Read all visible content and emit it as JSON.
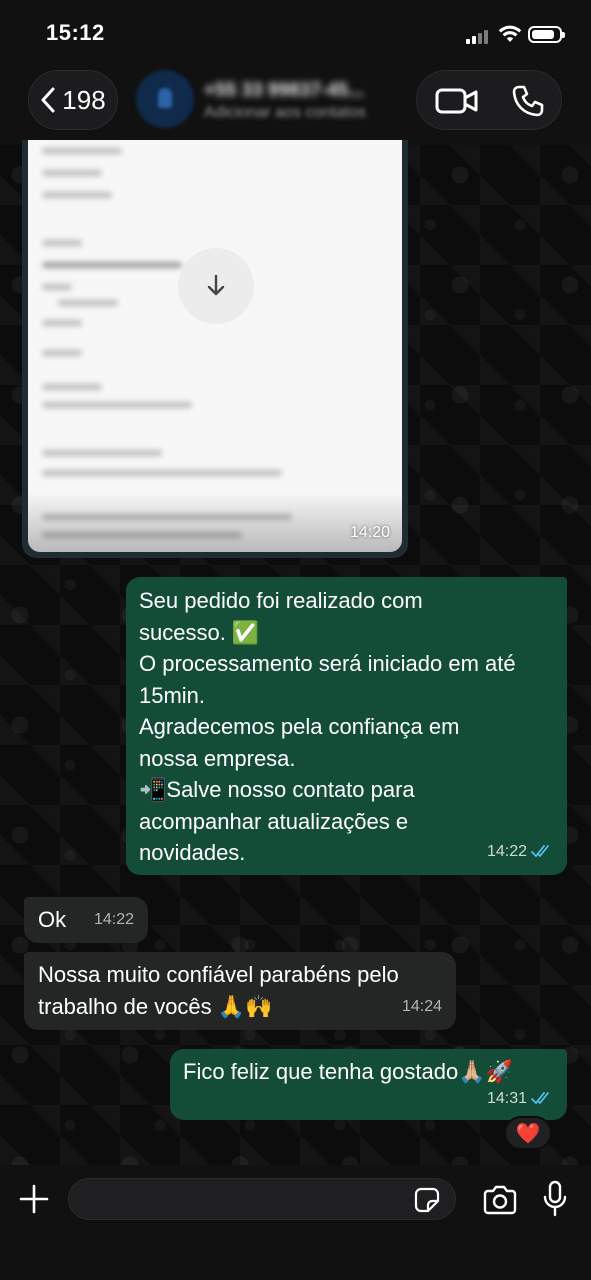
{
  "status_bar": {
    "time": "15:12"
  },
  "header": {
    "back_count": "198",
    "contact_name": "+55 33 99837-45...",
    "contact_subtitle": "Adicionar aos contatos"
  },
  "messages": {
    "image": {
      "time": "14:20"
    },
    "out1": {
      "lines": [
        "Seu pedido foi realizado com",
        "sucesso. ✅",
        "O processamento será iniciado em até",
        "15min.",
        "Agradecemos pela confiança em",
        "nossa empresa.",
        "📲Salve nosso contato para",
        "acompanhar atualizações e",
        "novidades."
      ],
      "time": "14:22"
    },
    "in1": {
      "text": "Ok",
      "time": "14:22"
    },
    "in2": {
      "lines": [
        "Nossa muito confiável parabéns pelo",
        "trabalho de vocês 🙏🙌"
      ],
      "time": "14:24"
    },
    "out2": {
      "text": "Fico feliz que tenha gostado🙏🏼🚀",
      "time": "14:31",
      "reaction": "❤️"
    }
  },
  "composer": {
    "placeholder": ""
  },
  "colors": {
    "outgoing": "#144d37",
    "incoming": "#242626",
    "read_ticks": "#53bdeb"
  }
}
